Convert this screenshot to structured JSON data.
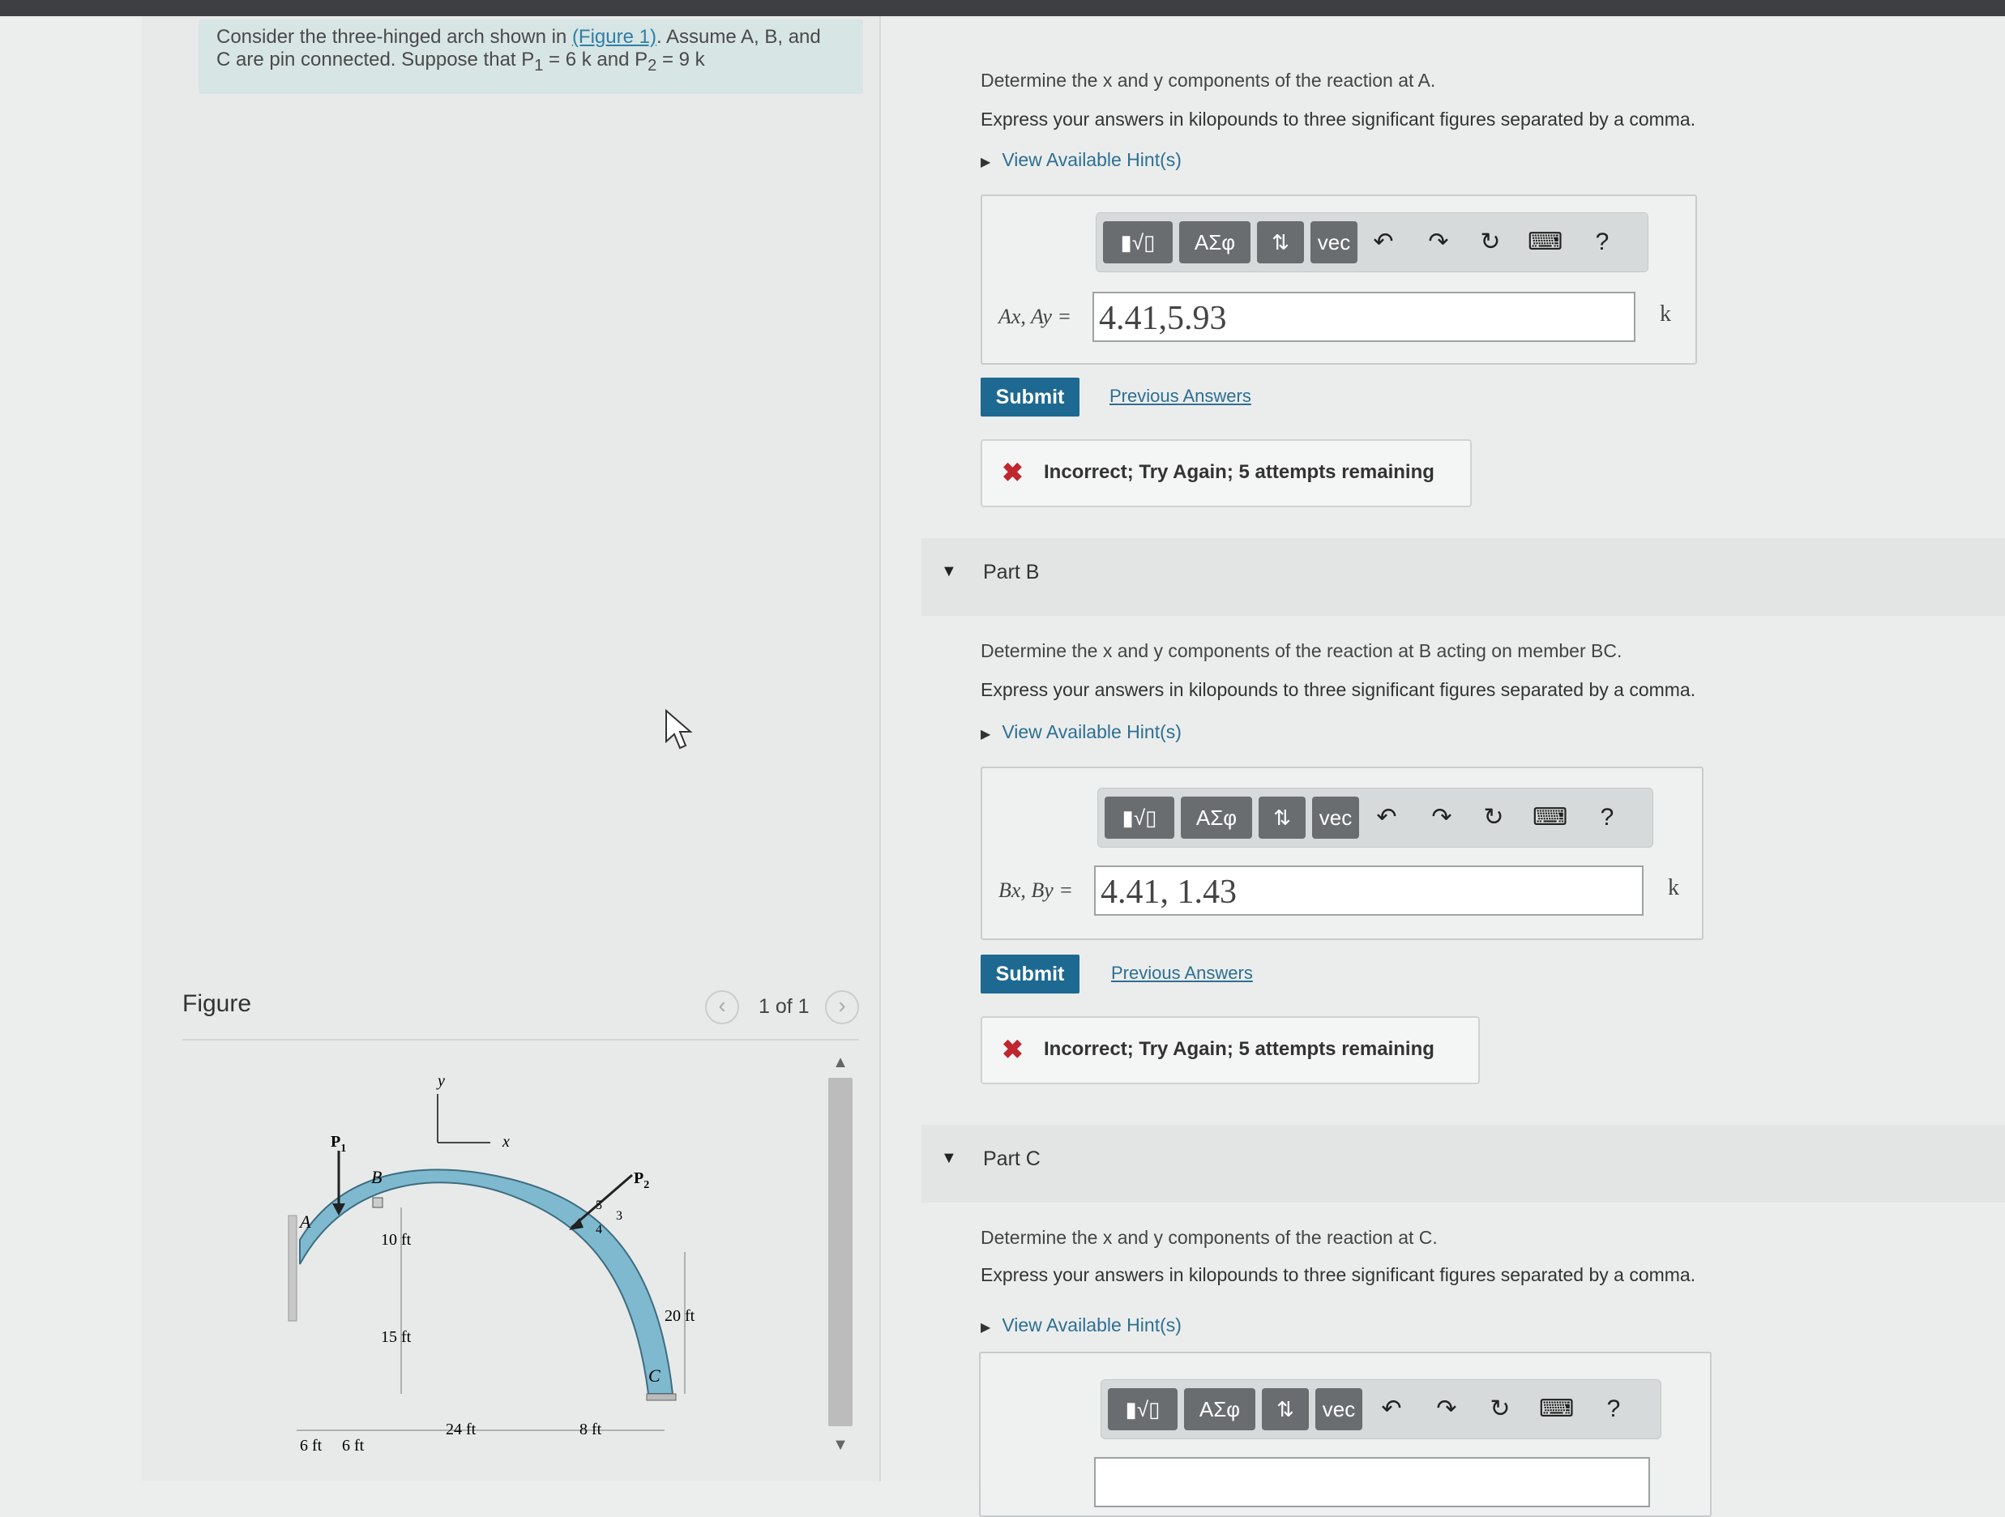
{
  "problem": {
    "text_1": "Consider the three-hinged arch shown in",
    "figure_link": "(Figure 1)",
    "text_2": ". Assume A, B, and",
    "text_3": "C are pin connected. Suppose that P",
    "text_4": " = 6 k and P",
    "text_5": " = 9 k"
  },
  "figure": {
    "label": "Figure",
    "counter": "1 of 1",
    "labels": {
      "p1": "P",
      "p1_sub": "1",
      "p2": "P",
      "p2_sub": "2",
      "a": "A",
      "b": "B",
      "c": "C",
      "x": "x",
      "y": "y",
      "slope_5": "5",
      "slope_3": "3",
      "slope_4": "4",
      "dim_10": "10 ft",
      "dim_15": "15 ft",
      "dim_20": "20 ft",
      "dim_24": "24 ft",
      "dim_8": "8 ft",
      "dim_6a": "6 ft",
      "dim_6b": "6 ft"
    }
  },
  "toolbar": {
    "templates": "▮√▯",
    "greek": "ΑΣφ",
    "arrows": "⇅",
    "vec": "vec",
    "undo": "↶",
    "redo": "↷",
    "reset": "↻",
    "keyboard": "⌨",
    "help": "?"
  },
  "part_a": {
    "prompt": "Determine the x and y components of the reaction at A.",
    "instructions": "Express your answers in kilopounds to three significant figures separated by a comma.",
    "hint": "View Available Hint(s)",
    "var_label": "Ax, Ay =",
    "answer": "4.41,5.93",
    "unit": "k",
    "submit": "Submit",
    "previous": "Previous Answers",
    "feedback": "Incorrect; Try Again; 5 attempts remaining"
  },
  "part_b": {
    "title": "Part B",
    "prompt": "Determine the x and y components of the reaction at B acting on member BC.",
    "instructions": "Express your answers in kilopounds to three significant figures separated by a comma.",
    "hint": "View Available Hint(s)",
    "var_label": "Bx, By =",
    "answer": "4.41, 1.43",
    "unit": "k",
    "submit": "Submit",
    "previous": "Previous Answers",
    "feedback": "Incorrect; Try Again; 5 attempts remaining"
  },
  "part_c": {
    "title": "Part C",
    "prompt": "Determine the x and y components of the reaction at C.",
    "instructions": "Express your answers in kilopounds to three significant figures separated by a comma.",
    "hint": "View Available Hint(s)"
  },
  "colors": {
    "intro_bg": "#d7e5e4",
    "submit_bg": "#1d6992",
    "link": "#2d6f93",
    "error": "#c0262d",
    "arch_fill": "#7fb9cf"
  }
}
